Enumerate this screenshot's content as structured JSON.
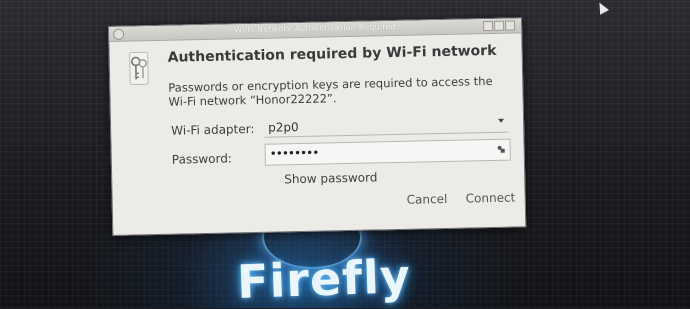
{
  "window": {
    "title": "Wi-Fi Network Authentication Required"
  },
  "dialog": {
    "heading": "Authentication required by Wi-Fi network",
    "description": "Passwords or encryption keys are required to access the Wi-Fi network “Honor22222”.",
    "adapter_label": "Wi-Fi adapter:",
    "adapter_value": "p2p0",
    "password_label": "Password:",
    "password_value": "••••••••",
    "show_password_label": "Show password",
    "cancel_label": "Cancel",
    "connect_label": "Connect"
  },
  "desktop": {
    "brand_text": "Firefly"
  },
  "icons": {
    "dialog_icon": "keys-icon",
    "password_field_icon": "key-icon"
  }
}
